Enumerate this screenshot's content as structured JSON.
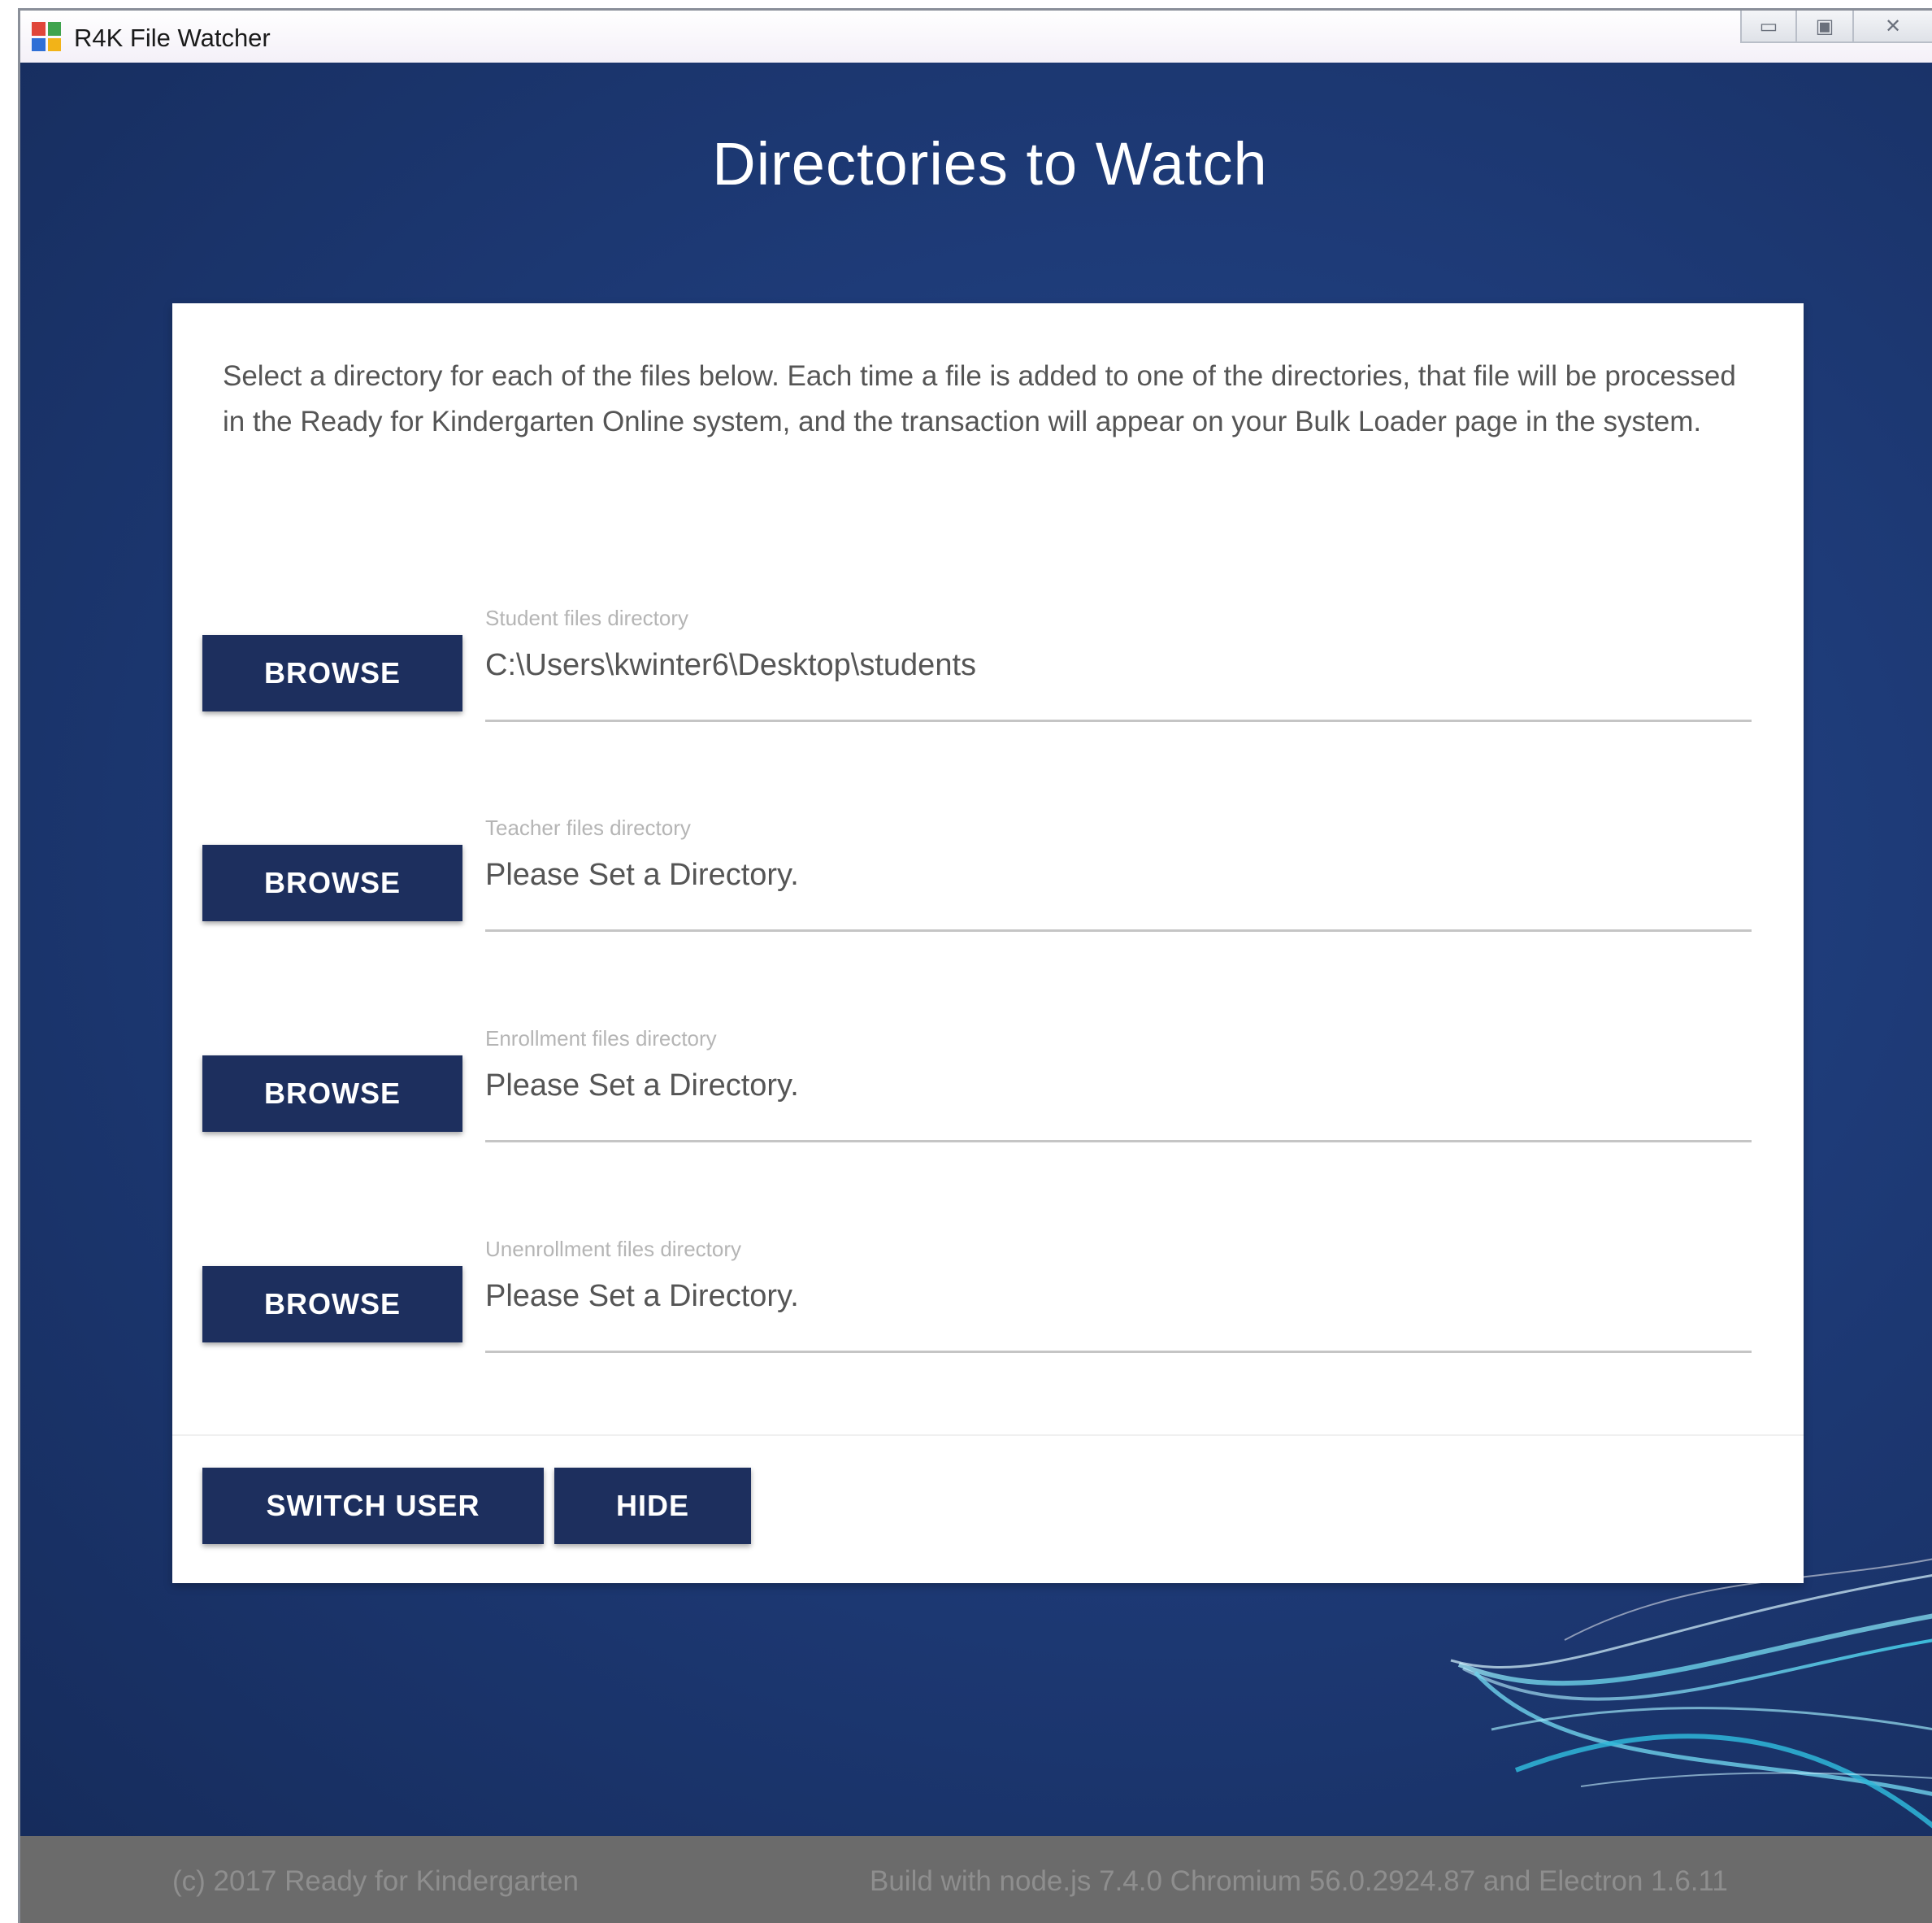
{
  "window": {
    "title": "R4K File Watcher",
    "controls": {
      "minimize": "▭",
      "maximize": "▣",
      "close": "✕"
    }
  },
  "page": {
    "title": "Directories to Watch",
    "intro": "Select a directory for each of the files below. Each time a file is added to one of the directories, that file will be processed in the Ready for Kindergarten Online system, and the transaction will appear on your Bulk Loader page in the system."
  },
  "directories": [
    {
      "button_label": "BROWSE",
      "label": "Student files directory",
      "value": "C:\\Users\\kwinter6\\Desktop\\students"
    },
    {
      "button_label": "BROWSE",
      "label": "Teacher files directory",
      "value": "Please Set a Directory."
    },
    {
      "button_label": "BROWSE",
      "label": "Enrollment files directory",
      "value": "Please Set a Directory."
    },
    {
      "button_label": "BROWSE",
      "label": "Unenrollment files directory",
      "value": "Please Set a Directory."
    }
  ],
  "actions": {
    "switch_user_label": "SWITCH USER",
    "hide_label": "HIDE"
  },
  "footer": {
    "copyright": "(c) 2017 Ready for Kindergarten",
    "build": "Build with node.js 7.4.0 Chromium 56.0.2924.87 and Electron 1.6.11"
  },
  "colors": {
    "background": "#1e3b78",
    "button": "#1d2f5e",
    "footer": "#6b6b6b"
  }
}
